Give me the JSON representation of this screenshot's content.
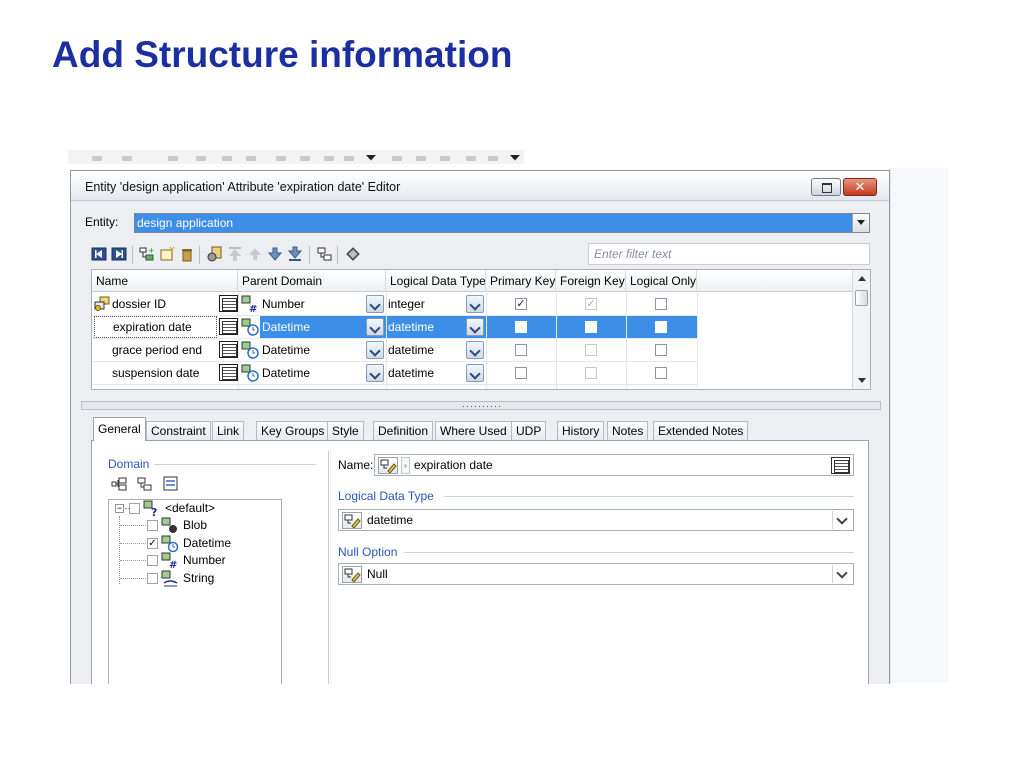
{
  "slide": {
    "title": "Add Structure information"
  },
  "dialog": {
    "title": "Entity 'design application' Attribute 'expiration date' Editor",
    "close_glyph": "✕",
    "entity_label": "Entity:",
    "entity_value": "design application",
    "filter_placeholder": "Enter filter text",
    "toolbar_icons": [
      "first-icon",
      "last-icon",
      "new-attribute-icon",
      "new-folder-icon",
      "delete-icon",
      "migrate-icon",
      "move-top-icon",
      "move-up-icon",
      "move-down-icon",
      "move-bottom-icon",
      "reorder-icon",
      "properties-icon"
    ]
  },
  "grid": {
    "columns": [
      "Name",
      "Parent Domain",
      "Logical Data Type",
      "Primary Key",
      "Foreign Key",
      "Logical Only"
    ],
    "rows": [
      {
        "name": "dossier ID",
        "parent_domain": "Number",
        "logical_type": "integer",
        "primary_key": true,
        "foreign_key": true,
        "logical_only": false,
        "selected": false
      },
      {
        "name": "expiration date",
        "parent_domain": "Datetime",
        "logical_type": "datetime",
        "primary_key": false,
        "foreign_key": false,
        "logical_only": false,
        "selected": true
      },
      {
        "name": "grace period end",
        "parent_domain": "Datetime",
        "logical_type": "datetime",
        "primary_key": false,
        "foreign_key": false,
        "logical_only": false,
        "selected": false
      },
      {
        "name": "suspension date",
        "parent_domain": "Datetime",
        "logical_type": "datetime",
        "primary_key": false,
        "foreign_key": false,
        "logical_only": false,
        "selected": false
      }
    ],
    "check_glyph": "✓",
    "colors": {
      "selection": "#3d8ee6"
    }
  },
  "splitter_grip": "··········",
  "tabs": [
    "General",
    "Constraint",
    "Link",
    "Key Groups",
    "Style",
    "Definition",
    "Where Used",
    "UDP",
    "History",
    "Notes",
    "Extended Notes"
  ],
  "general": {
    "domain_legend": "Domain",
    "tree": {
      "expander": "−",
      "root": "<default>",
      "items": [
        {
          "label": "Blob",
          "checked": false
        },
        {
          "label": "Datetime",
          "checked": true
        },
        {
          "label": "Number",
          "checked": false
        },
        {
          "label": "String",
          "checked": false
        }
      ]
    },
    "name_label": "Name:",
    "name_value": "expiration date",
    "name_arrow": "›",
    "ldt_legend": "Logical Data Type",
    "ldt_value": "datetime",
    "null_legend": "Null Option",
    "null_value": "Null"
  }
}
